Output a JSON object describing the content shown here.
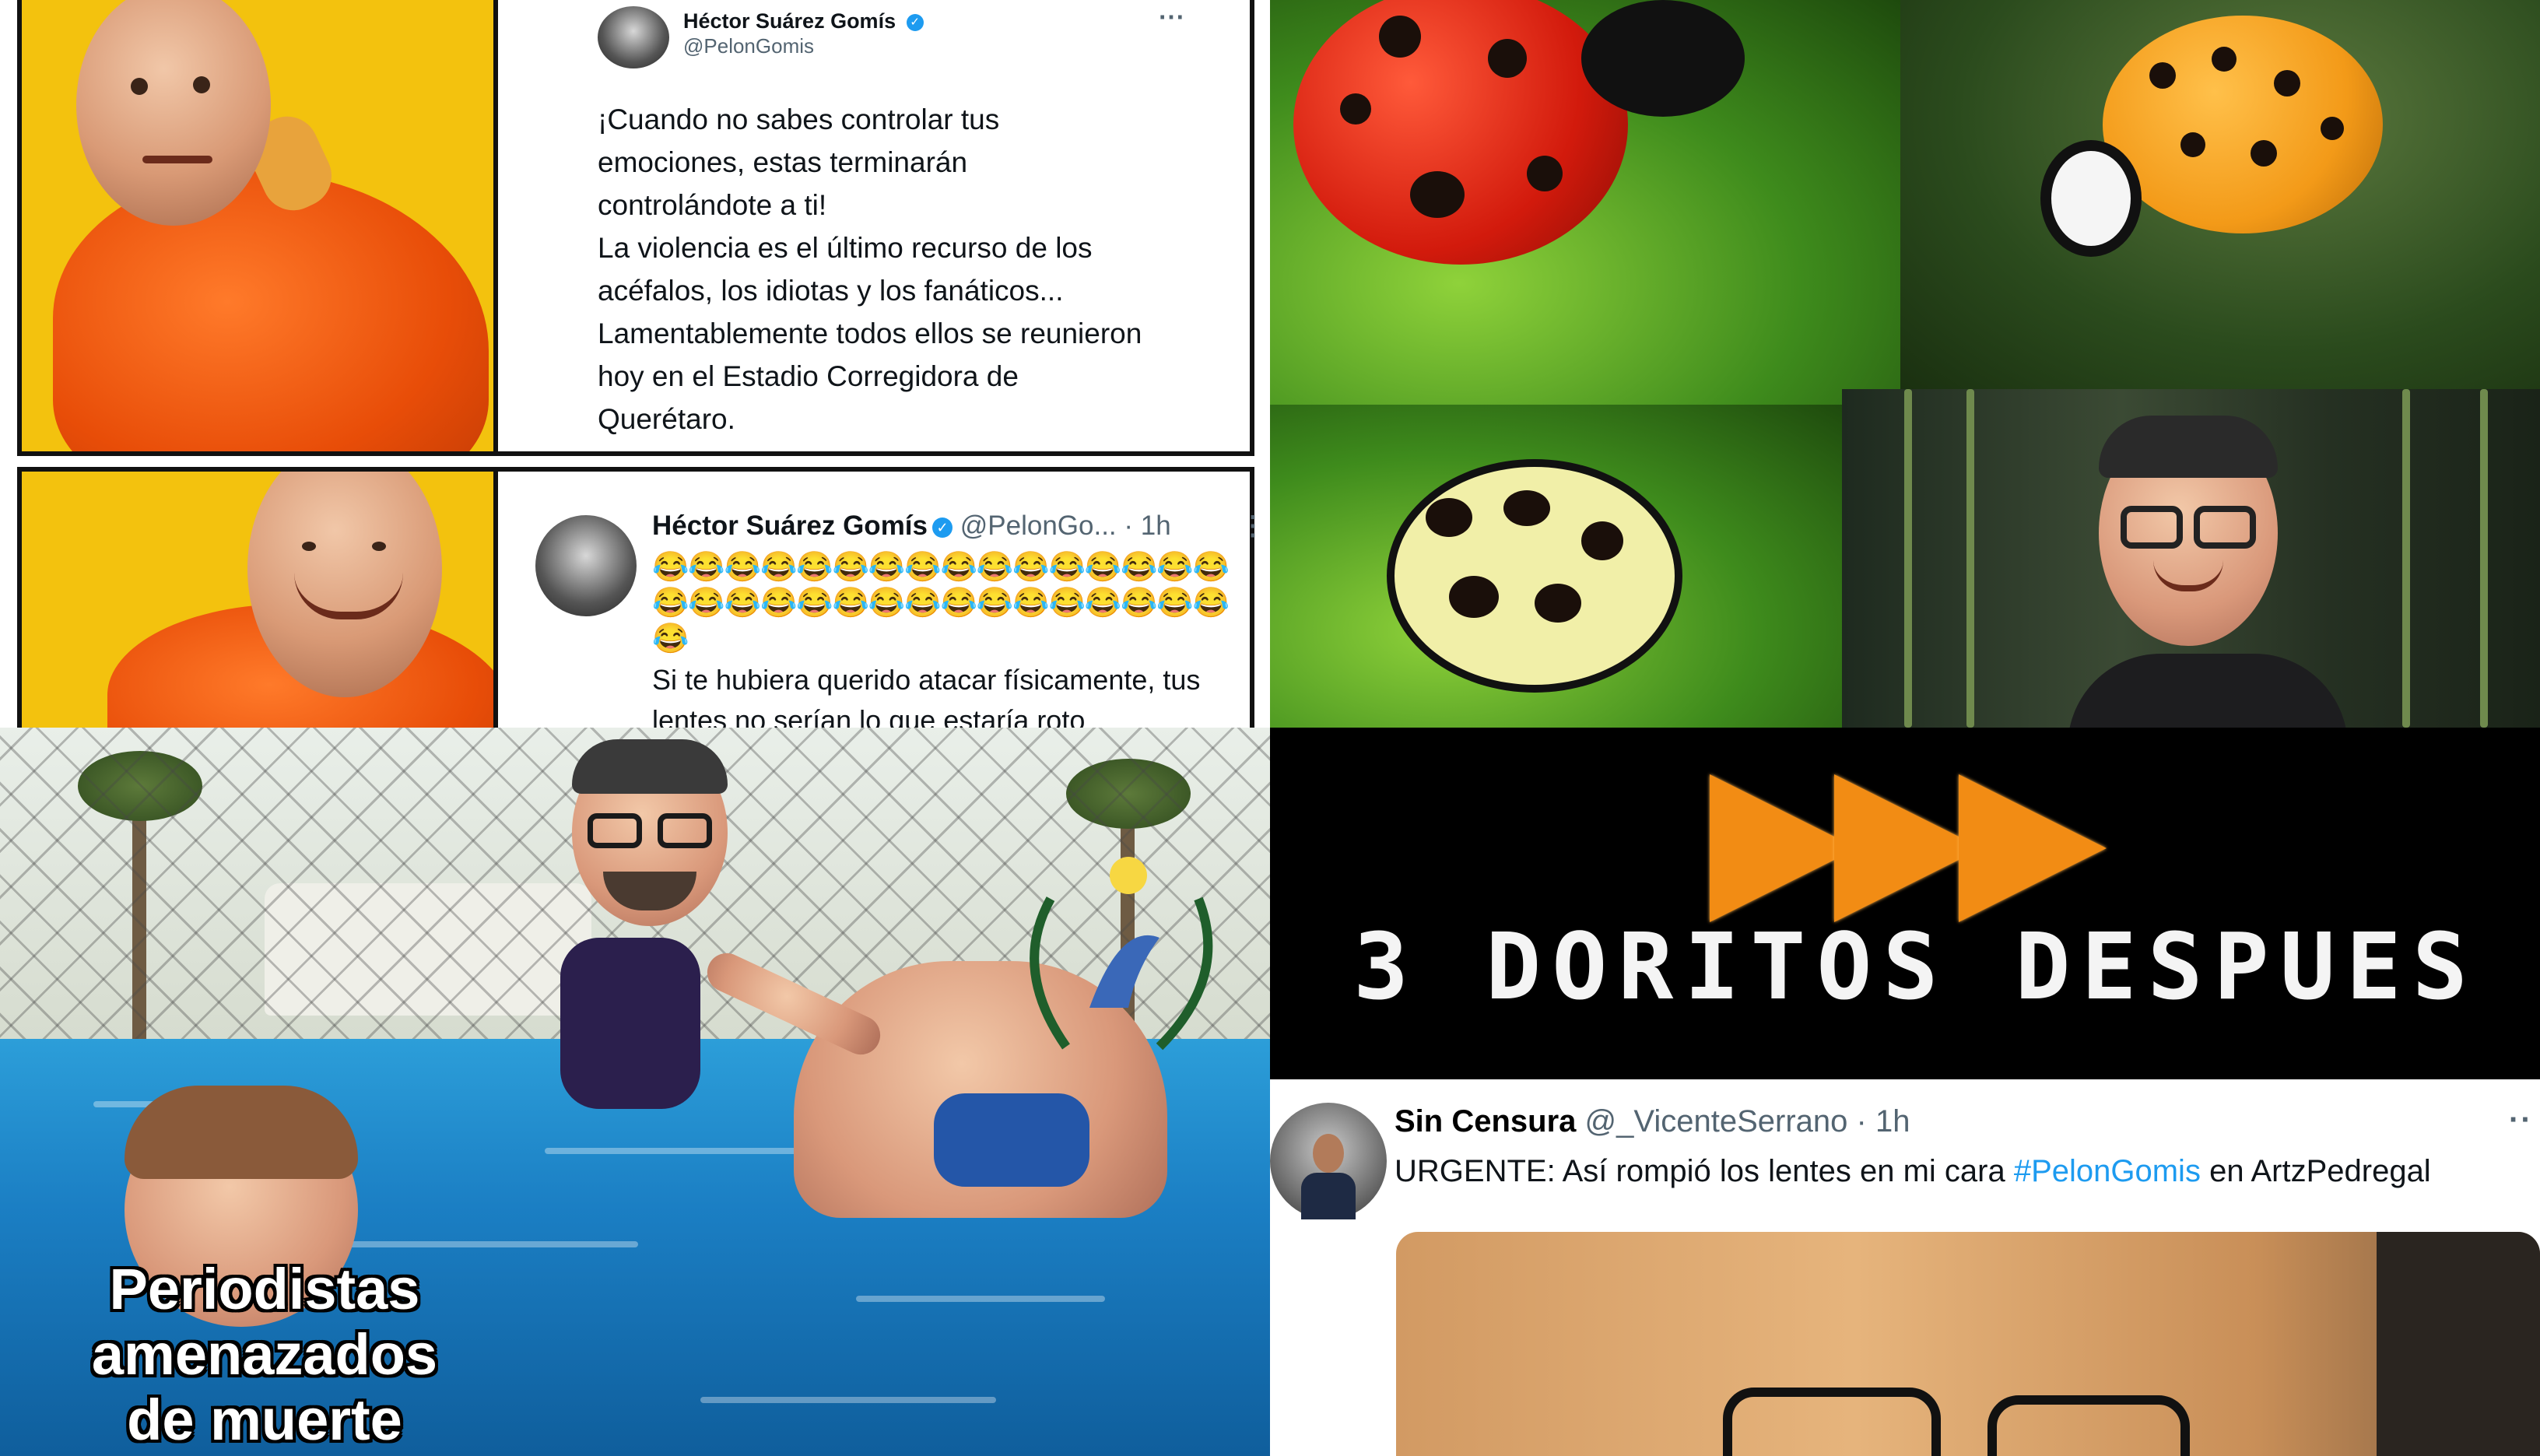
{
  "panel_top_left": {
    "tweet_1": {
      "author_name": "Héctor Suárez Gomís",
      "author_handle": "@PelonGomis",
      "more_icon": "⋯",
      "lines": [
        "¡Cuando no sabes controlar tus",
        "emociones, estas terminarán",
        "controlándote a ti!",
        "La violencia es el último recurso de los",
        "acéfalos, los idiotas y los fanáticos...",
        "Lamentablemente todos ellos se reunieron",
        "hoy en el Estadio Corregidora de",
        "Querétaro."
      ]
    },
    "tweet_2": {
      "author_name": "Héctor Suárez Gomís",
      "author_handle": "@PelonGo...",
      "time": "· 1h",
      "more_icon": "⋮",
      "emoji_line_1": "😂😂😂😂😂😂😂😂😂😂😂😂😂😂😂😂",
      "emoji_line_2": "😂😂😂😂😂😂😂😂😂😂😂😂😂😂😂😂",
      "emoji_line_3": "😂",
      "line_1": "Si te hubiera querido atacar físicamente, tus",
      "line_2": "lentes no serían lo que estaría roto"
    },
    "verified_icon": "✓"
  },
  "panel_bottom_left": {
    "caption_lines": [
      "Periodistas",
      "amenazados",
      "de muerte"
    ]
  },
  "panel_mid_right": {
    "text": "3 DORITOS DESPUES",
    "accent_color": "#f28c14"
  },
  "panel_bottom_right": {
    "author_name": "Sin Censura",
    "author_handle": "@_VicenteSerrano",
    "time": "· 1h",
    "more_icon": "··",
    "body_before": "URGENTE: Así rompió los lentes en mi cara ",
    "hashtag": "#PelonGomis",
    "body_after": " en ArtzPedregal",
    "hashtag_color": "#1d9bf0"
  }
}
